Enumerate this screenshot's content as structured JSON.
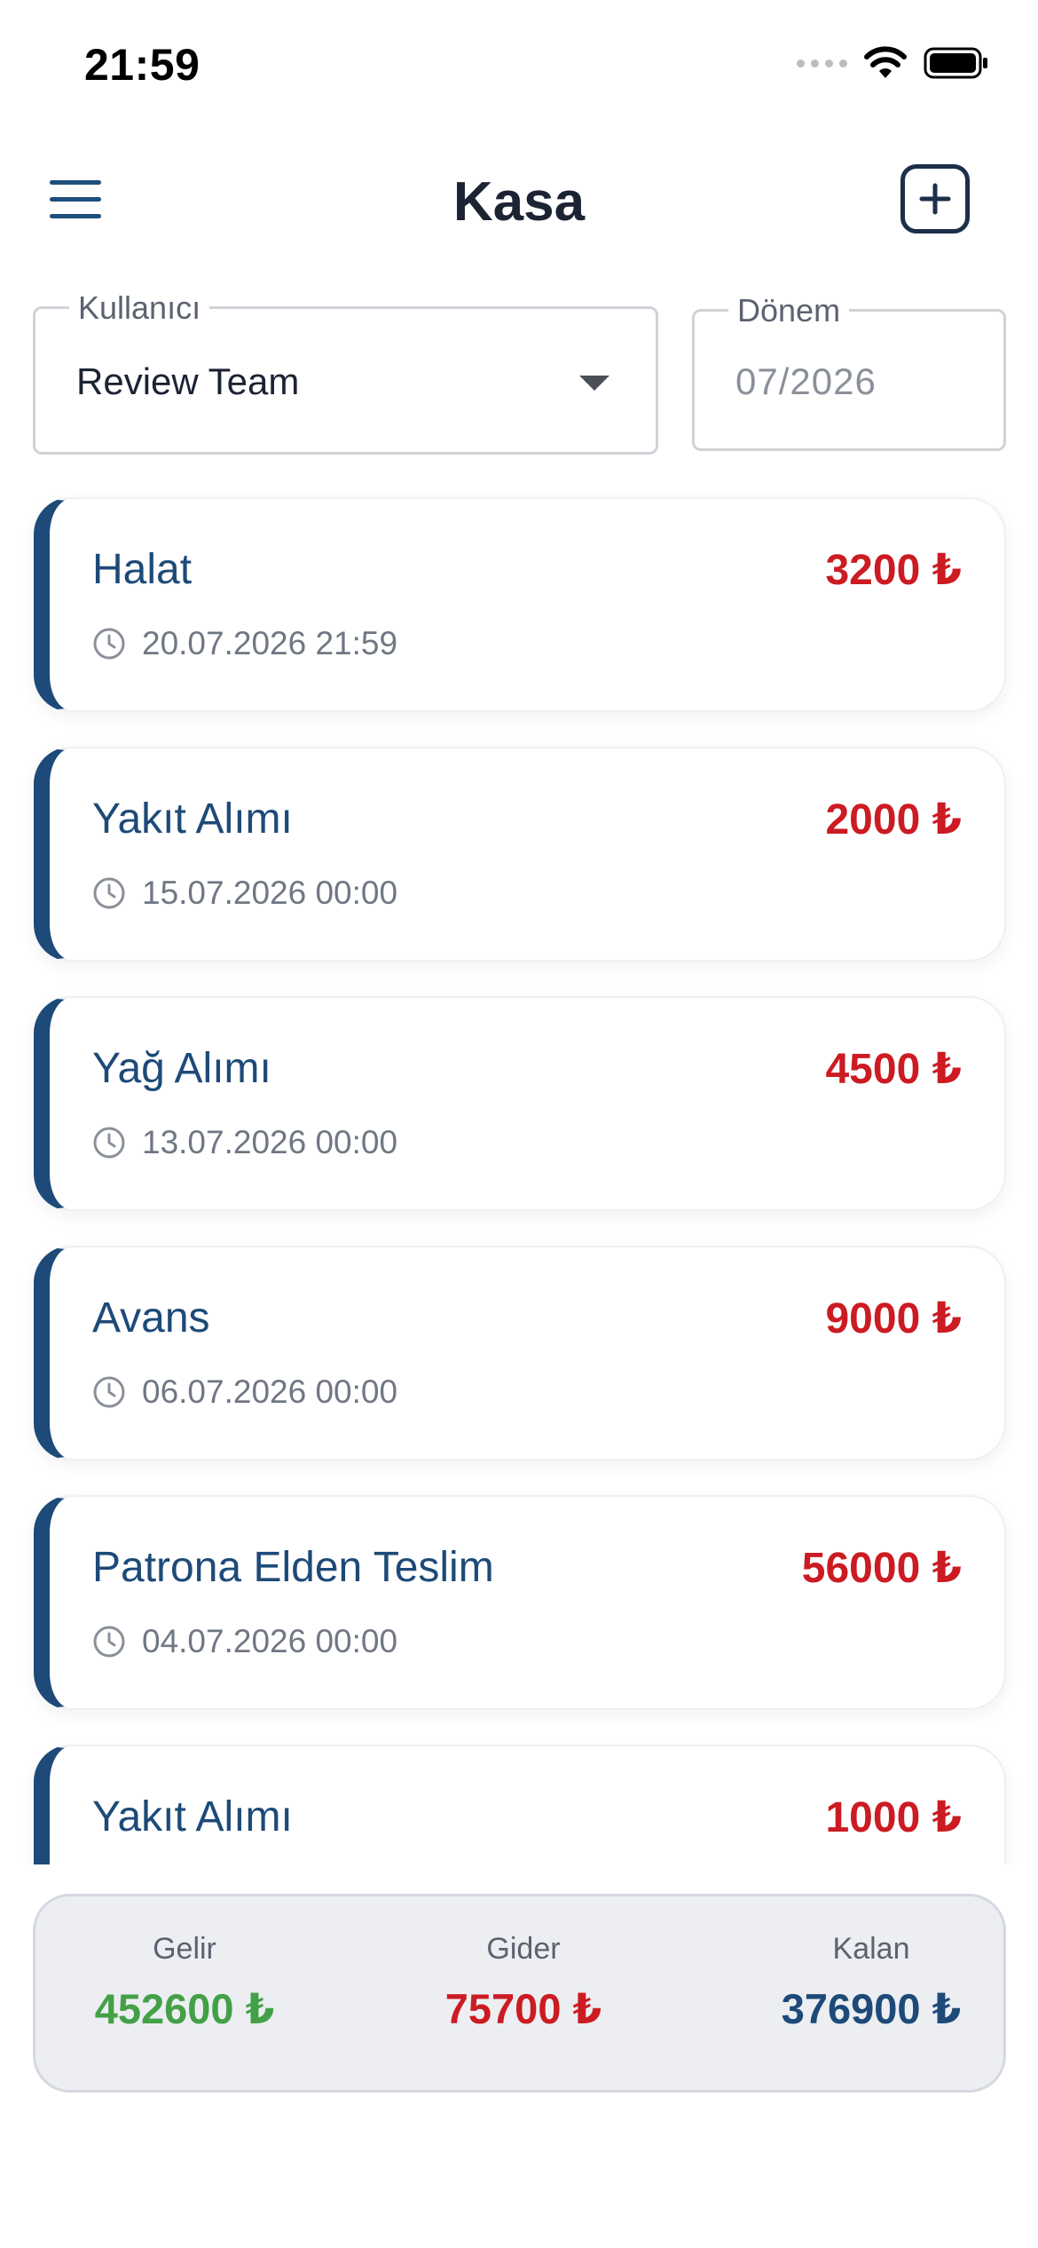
{
  "status_bar": {
    "time": "21:59"
  },
  "header": {
    "title": "Kasa"
  },
  "filters": {
    "user": {
      "label": "Kullanıcı",
      "value": "Review Team"
    },
    "period": {
      "label": "Dönem",
      "placeholder": "07/2026"
    }
  },
  "transactions": [
    {
      "title": "Halat",
      "amount": "3200 ₺",
      "date": "20.07.2026 21:59"
    },
    {
      "title": "Yakıt Alımı",
      "amount": "2000 ₺",
      "date": "15.07.2026 00:00"
    },
    {
      "title": "Yağ Alımı",
      "amount": "4500 ₺",
      "date": "13.07.2026 00:00"
    },
    {
      "title": "Avans",
      "amount": "9000 ₺",
      "date": "06.07.2026 00:00"
    },
    {
      "title": "Patrona Elden Teslim",
      "amount": "56000 ₺",
      "date": "04.07.2026 00:00"
    },
    {
      "title": "Yakıt Alımı",
      "amount": "1000 ₺",
      "date": ""
    }
  ],
  "summary": {
    "income_label": "Gelir",
    "income_value": "452600 ₺",
    "expense_label": "Gider",
    "expense_value": "75700 ₺",
    "balance_label": "Kalan",
    "balance_value": "376900 ₺"
  },
  "colors": {
    "accent": "#1d4a78",
    "expense": "#cc1b22",
    "income": "#43a047"
  },
  "icons": [
    "menu-icon",
    "add-icon",
    "clock-icon",
    "dropdown-arrow-icon",
    "wifi-icon",
    "battery-icon",
    "signal-icon"
  ]
}
